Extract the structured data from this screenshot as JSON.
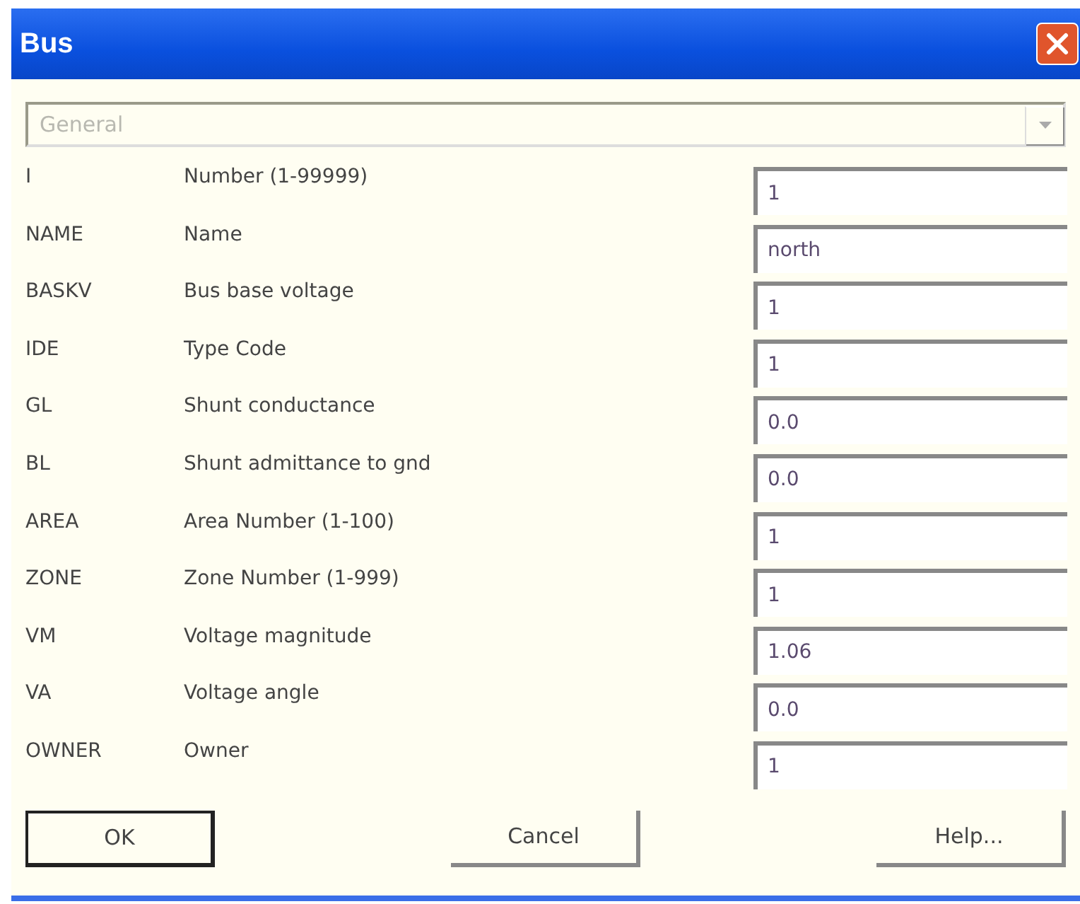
{
  "window": {
    "title": "Bus"
  },
  "section_dropdown": {
    "value": "General",
    "disabled": true
  },
  "fields": [
    {
      "code": "I",
      "label": "Number (1-99999)",
      "value": "1"
    },
    {
      "code": "NAME",
      "label": "Name",
      "value": "north"
    },
    {
      "code": "BASKV",
      "label": "Bus base voltage",
      "value": "1"
    },
    {
      "code": "IDE",
      "label": "Type Code",
      "value": "1"
    },
    {
      "code": "GL",
      "label": "Shunt conductance",
      "value": "0.0"
    },
    {
      "code": "BL",
      "label": "Shunt admittance to gnd",
      "value": "0.0"
    },
    {
      "code": "AREA",
      "label": "Area Number (1-100)",
      "value": "1"
    },
    {
      "code": "ZONE",
      "label": "Zone Number (1-999)",
      "value": "1"
    },
    {
      "code": "VM",
      "label": "Voltage magnitude",
      "value": "1.06"
    },
    {
      "code": "VA",
      "label": "Voltage angle",
      "value": "0.0"
    },
    {
      "code": "OWNER",
      "label": "Owner",
      "value": "1"
    }
  ],
  "buttons": [
    {
      "label": "OK",
      "default": true
    },
    {
      "label": "Cancel",
      "default": false
    },
    {
      "label": "Help...",
      "default": false
    }
  ]
}
